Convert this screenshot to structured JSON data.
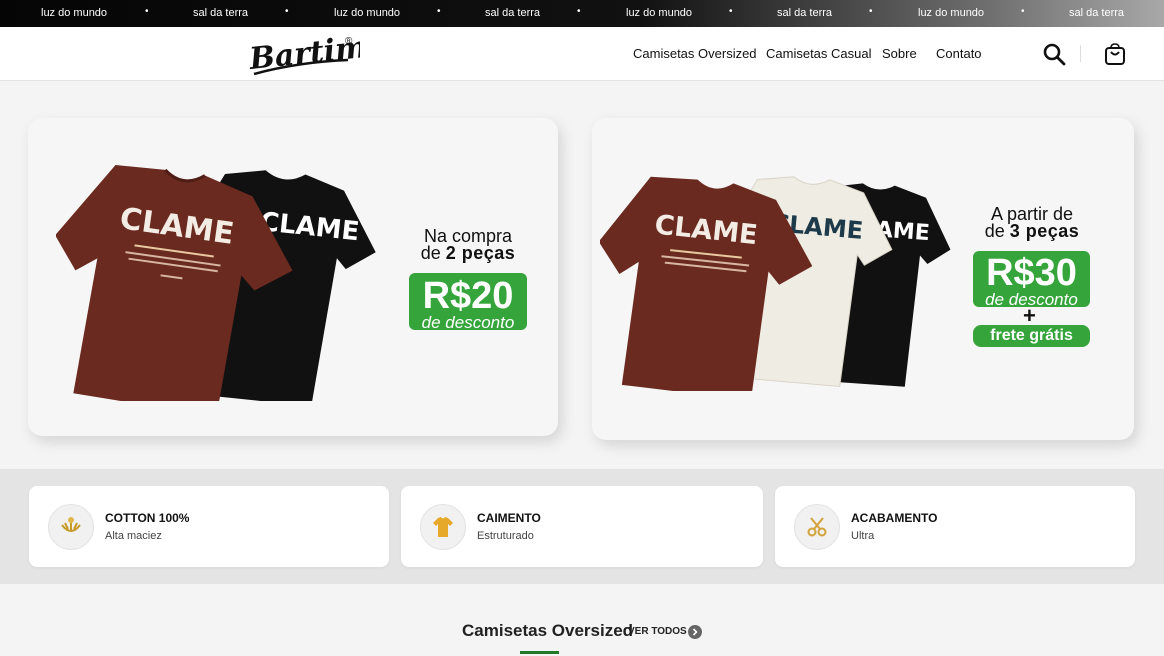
{
  "marquee": {
    "items": [
      "luz do mundo",
      "sal da terra",
      "luz do mundo",
      "sal da terra",
      "luz do mundo",
      "sal da terra",
      "luz do mundo",
      "sal da terra"
    ],
    "separator": "•"
  },
  "header": {
    "logo_text": "Bartimeu",
    "logo_mark": "®",
    "nav": [
      "Camisetas Oversized",
      "Camisetas Casual",
      "Sobre",
      "Contato"
    ]
  },
  "banners": [
    {
      "shirt_prints": [
        "CLAME",
        "CLAME"
      ],
      "line1": "Na compra",
      "line2_prefix": "de ",
      "line2_bold": "2 peças",
      "price": "R$20",
      "price_sub": "de desconto"
    },
    {
      "shirt_prints": [
        "CLAME",
        "CLAME",
        "CLAME"
      ],
      "line1": "A partir de",
      "line2_prefix": "de ",
      "line2_bold": "3 peças",
      "price": "R$30",
      "price_sub": "de desconto",
      "plus": "+",
      "extra": "frete grátis"
    }
  ],
  "features": [
    {
      "title": "COTTON 100%",
      "subtitle": "Alta maciez",
      "icon": "cotton-icon"
    },
    {
      "title": "CAIMENTO",
      "subtitle": "Estruturado",
      "icon": "shirt-icon"
    },
    {
      "title": "ACABAMENTO",
      "subtitle": "Ultra",
      "icon": "scissors-icon"
    }
  ],
  "section": {
    "title": "Camisetas Oversized",
    "see_all": "VER TODOS"
  },
  "colors": {
    "accent_green": "#35a53b",
    "underline_green": "#1f7a2a",
    "shirt_maroon": "#6b2a1f",
    "shirt_black": "#111111",
    "shirt_cream": "#efece3"
  }
}
